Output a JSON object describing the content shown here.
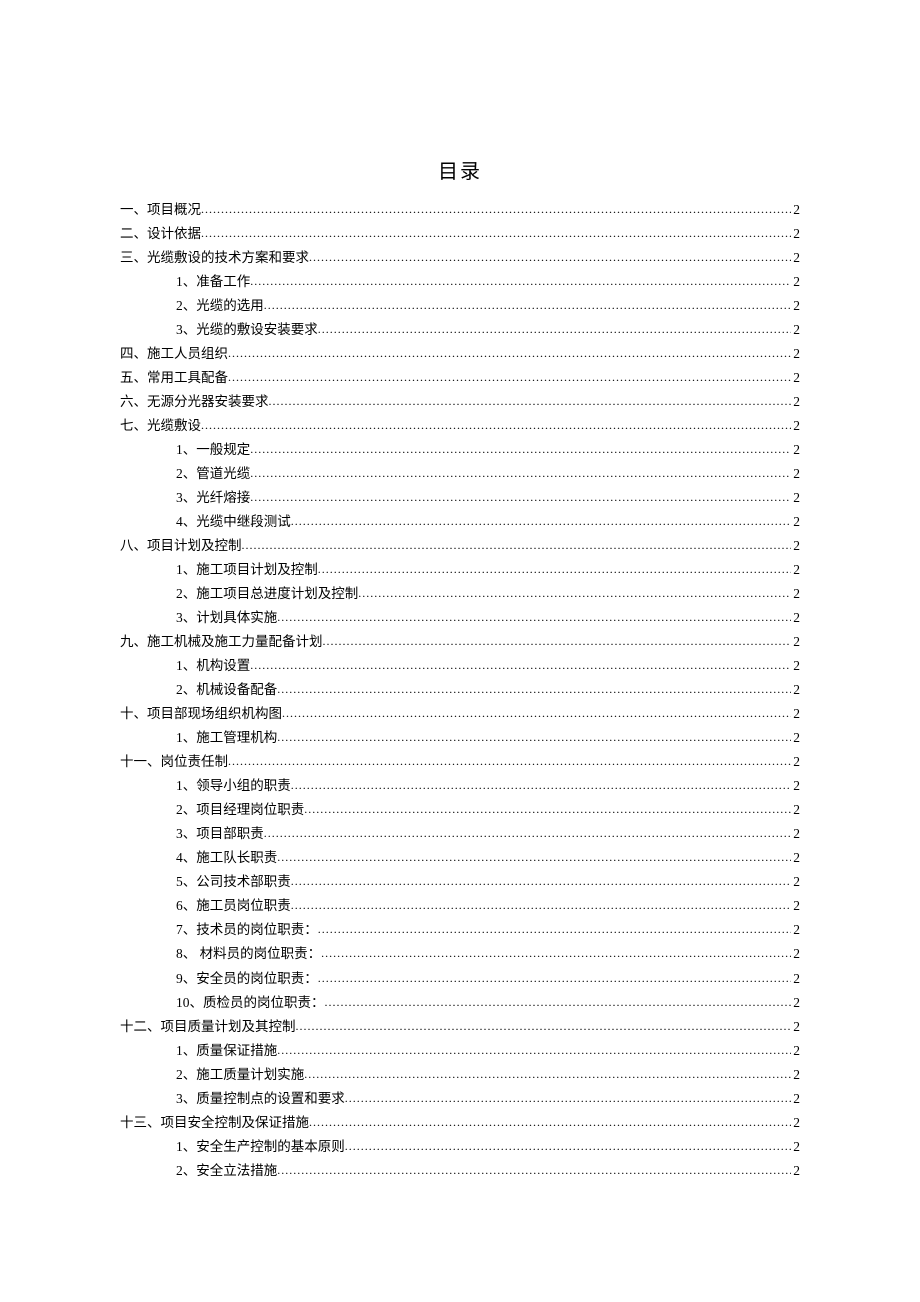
{
  "title": "目录",
  "entries": [
    {
      "level": 1,
      "label": "一、项目概况",
      "page": "2"
    },
    {
      "level": 1,
      "label": "二、设计依据",
      "page": "2"
    },
    {
      "level": 1,
      "label": "三、光缆敷设的技术方案和要求",
      "page": "2"
    },
    {
      "level": 2,
      "label": "1、准备工作",
      "page": "2"
    },
    {
      "level": 2,
      "label": "2、光缆的选用",
      "page": "2"
    },
    {
      "level": 2,
      "label": "3、光缆的敷设安装要求",
      "page": "2"
    },
    {
      "level": 1,
      "label": "四、施工人员组织",
      "page": "2"
    },
    {
      "level": 1,
      "label": "五、常用工具配备",
      "page": "2"
    },
    {
      "level": 1,
      "label": "六、无源分光器安装要求",
      "page": "2"
    },
    {
      "level": 1,
      "label": "七、光缆敷设",
      "page": "2"
    },
    {
      "level": 2,
      "label": "1、一般规定",
      "page": "2"
    },
    {
      "level": 2,
      "label": "2、管道光缆",
      "page": "2"
    },
    {
      "level": 2,
      "label": "3、光纤熔接",
      "page": "2"
    },
    {
      "level": 2,
      "label": "4、光缆中继段测试",
      "page": "2"
    },
    {
      "level": 1,
      "label": "八、项目计划及控制",
      "page": "2"
    },
    {
      "level": 2,
      "label": "1、施工项目计划及控制",
      "page": "2"
    },
    {
      "level": 2,
      "label": "2、施工项目总进度计划及控制",
      "page": "2"
    },
    {
      "level": 2,
      "label": "3、计划具体实施",
      "page": "2"
    },
    {
      "level": 1,
      "label": "九、施工机械及施工力量配备计划",
      "page": "2"
    },
    {
      "level": 2,
      "label": "1、机构设置",
      "page": "2"
    },
    {
      "level": 2,
      "label": "2、机械设备配备",
      "page": "2"
    },
    {
      "level": 1,
      "label": "十、项目部现场组织机构图",
      "page": "2"
    },
    {
      "level": 2,
      "label": "1、施工管理机构",
      "page": "2"
    },
    {
      "level": 1,
      "label": "十一、岗位责任制",
      "page": "2"
    },
    {
      "level": 2,
      "label": "1、领导小组的职责",
      "page": "2"
    },
    {
      "level": 2,
      "label": "2、项目经理岗位职责",
      "page": "2"
    },
    {
      "level": 2,
      "label": "3、项目部职责",
      "page": "2"
    },
    {
      "level": 2,
      "label": "4、施工队长职责",
      "page": "2"
    },
    {
      "level": 2,
      "label": "5、公司技术部职责",
      "page": "2"
    },
    {
      "level": 2,
      "label": "6、施工员岗位职责",
      "page": "2"
    },
    {
      "level": 2,
      "label": "7、技术员的岗位职责：",
      "page": "2"
    },
    {
      "level": 2,
      "label": "8、 材料员的岗位职责：",
      "page": "2"
    },
    {
      "level": 2,
      "label": "9、安全员的岗位职责：",
      "page": "2"
    },
    {
      "level": 2,
      "label": "10、质检员的岗位职责：",
      "page": "2"
    },
    {
      "level": 1,
      "label": "十二、项目质量计划及其控制",
      "page": "2"
    },
    {
      "level": 2,
      "label": "1、质量保证措施",
      "page": "2"
    },
    {
      "level": 2,
      "label": "2、施工质量计划实施",
      "page": "2"
    },
    {
      "level": 2,
      "label": "3、质量控制点的设置和要求",
      "page": "2"
    },
    {
      "level": 1,
      "label": "十三、项目安全控制及保证措施",
      "page": "2"
    },
    {
      "level": 2,
      "label": "1、安全生产控制的基本原则",
      "page": "2"
    },
    {
      "level": 2,
      "label": "2、安全立法措施",
      "page": "2"
    }
  ]
}
